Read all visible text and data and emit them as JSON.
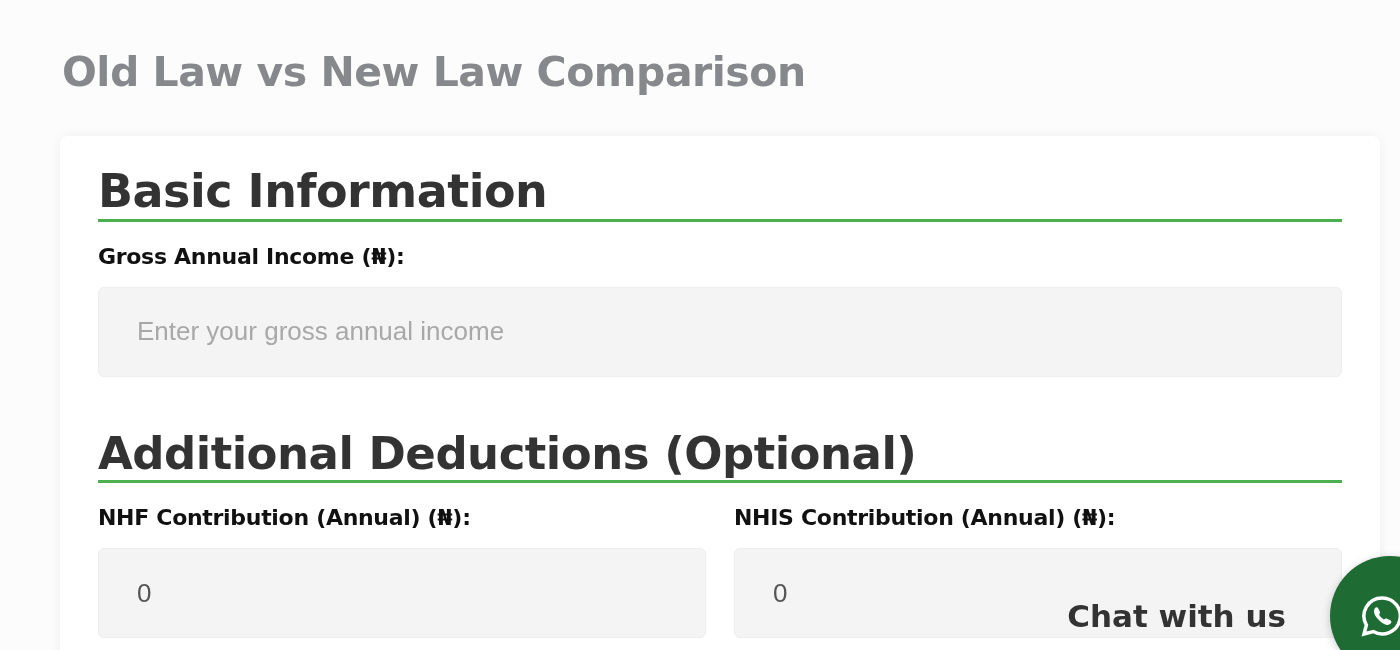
{
  "page_title": "Old Law vs New Law Comparison",
  "sections": [
    {
      "heading": "Basic Information",
      "fields": [
        {
          "label": "Gross Annual Income (₦):",
          "placeholder": "Enter your gross annual income"
        }
      ]
    },
    {
      "heading": "Additional Deductions (Optional)",
      "fields": [
        {
          "label": "NHF Contribution (Annual) (₦):",
          "value": "0"
        },
        {
          "label": "NHIS Contribution (Annual) (₦):",
          "value": "0"
        }
      ]
    }
  ],
  "chat_widget": {
    "label": "Chat with us"
  }
}
